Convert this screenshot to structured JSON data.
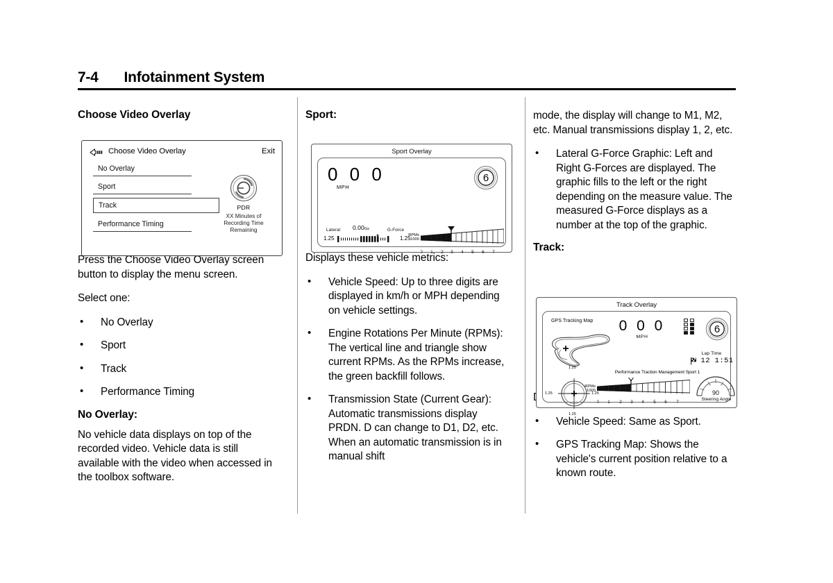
{
  "header": {
    "page_number": "7-4",
    "chapter_title": "Infotainment System"
  },
  "column_left": {
    "heading": "Choose Video Overlay",
    "figure": {
      "title": "Choose Video Overlay",
      "back_icon": "back-arrow-icon",
      "exit_label": "Exit",
      "menu_items": [
        {
          "label": "No Overlay",
          "selected": false
        },
        {
          "label": "Sport",
          "selected": false
        },
        {
          "label": "Track",
          "selected": true
        },
        {
          "label": "Performance Timing",
          "selected": false
        }
      ],
      "pdr_icon": "pdr-dial-icon",
      "pdr_label": "PDR",
      "recording_time": "XX Minutes of Recording Time Remaining"
    },
    "paragraph_1": "Press the Choose Video Overlay screen button to display the menu screen.",
    "paragraph_2": "Select one:",
    "bullets": [
      "No Overlay",
      "Sport",
      "Track",
      "Performance Timing"
    ],
    "heading_2": "No Overlay:",
    "paragraph_3": "No vehicle data displays on top of the recorded video. Vehicle data is still available with the video when accessed in the toolbox software."
  },
  "column_middle": {
    "heading": "Sport:",
    "figure": {
      "caption": "Sport Overlay",
      "speed_digits": "0 0 0",
      "speed_unit": "MPH",
      "gear_value": "6",
      "lateral_label": "Lateral",
      "g_value": "0.00",
      "g_unit": "Gs",
      "gforce_label": "G-Force",
      "g_left_max": "1.25",
      "g_right_max": "1.25",
      "rpm_unit_line1": "RPMs",
      "rpm_unit_line2": "1000",
      "rpm_ticks": [
        "0",
        "1",
        "2",
        "3",
        "4",
        "5",
        "6",
        "7"
      ]
    },
    "intro": "Displays these vehicle metrics:",
    "bullets": [
      "Vehicle Speed: Up to three digits are displayed in km/h or MPH depending on vehicle settings.",
      "Engine Rotations Per Minute (RPMs): The vertical line and triangle show current RPMs. As the RPMs increase, the green backfill follows.",
      "Transmission State (Current Gear): Automatic transmissions display PRDN. D can change to D1, D2, etc. When an automatic transmission is in manual shift"
    ]
  },
  "column_right": {
    "continued_paragraph": "mode, the display will change to M1, M2, etc. Manual transmissions display 1, 2, etc.",
    "bullets_top": [
      "Lateral G-Force Graphic: Left and Right G-Forces are displayed. The graphic fills to the left or the right depending on the measure value. The measured G-Force displays as a number at the top of the graphic."
    ],
    "heading": "Track:",
    "figure": {
      "caption": "Track Overlay",
      "map_label": "GPS Tracking Map",
      "speed_digits": "0 0 0",
      "speed_unit": "MPH",
      "gear_value": "6",
      "lap_time_label": "Lap Time",
      "lap_time_value": "12 1:51",
      "lap_flag_icon": "checkered-flag-icon",
      "ptm_label": "Performance Traction Management Sport 1",
      "rpm_unit_line1": "RPMs",
      "rpm_unit_line2": "1000",
      "rpm_ticks": [
        "0",
        "1",
        "2",
        "3",
        "4",
        "5",
        "6",
        "7"
      ],
      "g_circle_top": "1.25",
      "g_circle_left": "1.25",
      "g_circle_right": "1.25",
      "g_circle_bottom": "1.25",
      "steering_value": "90",
      "steering_label": "Steering Angle"
    },
    "intro": "Displays these vehicle metrics:",
    "bullets": [
      "Vehicle Speed: Same as Sport.",
      "GPS Tracking Map: Shows the vehicle's current position relative to a known route."
    ]
  }
}
